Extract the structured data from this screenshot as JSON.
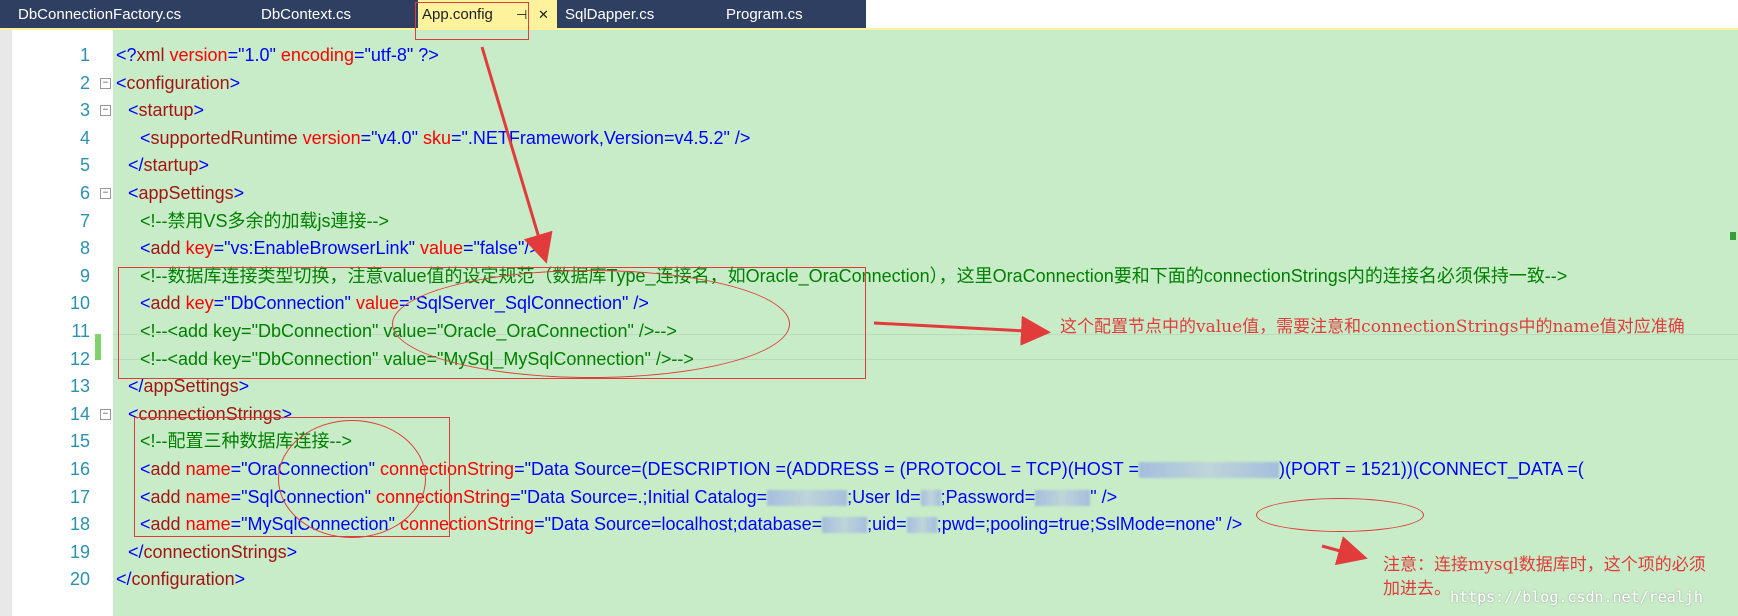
{
  "tabs": [
    {
      "label": "DbConnectionFactory.cs"
    },
    {
      "label": "DbContext.cs"
    },
    {
      "label": "App.config",
      "active": true,
      "pin": "⊣",
      "close": "✕"
    },
    {
      "label": "SqlDapper.cs"
    },
    {
      "label": "Program.cs"
    }
  ],
  "line_numbers": [
    "1",
    "2",
    "3",
    "4",
    "5",
    "6",
    "7",
    "8",
    "9",
    "10",
    "11",
    "12",
    "13",
    "14",
    "15",
    "16",
    "17",
    "18",
    "19",
    "20"
  ],
  "code": {
    "l1": {
      "open": "<?",
      "name": "xml",
      "a1": " version",
      "eq1": "=",
      "v1": "\"1.0\"",
      "a2": " encoding",
      "eq2": "=",
      "v2": "\"utf-8\"",
      "close": " ?>"
    },
    "l2": {
      "open": "<",
      "name": "configuration",
      "close": ">"
    },
    "l3": {
      "open": "<",
      "name": "startup",
      "close": ">"
    },
    "l4": {
      "open": "<",
      "name": "supportedRuntime",
      "a1": " version",
      "eq1": "=",
      "v1": "\"v4.0\"",
      "a2": " sku",
      "eq2": "=",
      "v2": "\".NETFramework,Version=v4.5.2\"",
      "close": " />"
    },
    "l5": {
      "open": "</",
      "name": "startup",
      "close": ">"
    },
    "l6": {
      "open": "<",
      "name": "appSettings",
      "close": ">"
    },
    "l7": {
      "comment": "<!--禁用VS多余的加载js連接-->"
    },
    "l8": {
      "open": "<",
      "name": "add",
      "a1": " key",
      "eq1": "=",
      "v1": "\"vs:EnableBrowserLink\"",
      "a2": " value",
      "eq2": "=",
      "v2": "\"false\"",
      "close": "/>"
    },
    "l9": {
      "comment": "<!--数据库连接类型切换，注意value值的设定规范（数据库Type_连接名，如Oracle_OraConnection），这里OraConnection要和下面的connectionStrings内的连接名必须保持一致-->"
    },
    "l10": {
      "open": "<",
      "name": "add",
      "a1": " key",
      "eq1": "=",
      "v1": "\"DbConnection\"",
      "a2": " value",
      "eq2": "=",
      "v2": "\"SqlServer_SqlConnection\"",
      "close": " />"
    },
    "l11": {
      "comment": "<!--<add key=\"DbConnection\" value=\"Oracle_OraConnection\" />-->"
    },
    "l12": {
      "comment": "<!--<add key=\"DbConnection\" value=\"MySql_MySqlConnection\" />-->"
    },
    "l13": {
      "open": "</",
      "name": "appSettings",
      "close": ">"
    },
    "l14": {
      "open": "<",
      "name": "connectionStrings",
      "close": ">"
    },
    "l15": {
      "comment": "<!--配置三种数据库连接-->"
    },
    "l16": {
      "open": "<",
      "name": "add",
      "a1": " name",
      "eq1": "=",
      "v1": "\"OraConnection\"",
      "a2": "  connectionString",
      "eq2": "=",
      "v2a": "\"Data Source=(DESCRIPTION =(ADDRESS = (PROTOCOL = TCP)(HOST =",
      "v2b": ")(PORT = 1521))(CONNECT_DATA =("
    },
    "l17": {
      "open": "<",
      "name": "add",
      "a1": " name",
      "eq1": "=",
      "v1": "\"SqlConnection\"",
      "a2": "  connectionString",
      "eq2": "=",
      "v2a": "\"Data Source=.;Initial Catalog=",
      "v2b": ";User Id=",
      "v2c": ";Password=",
      "v2d": "\"",
      "close": " />"
    },
    "l18": {
      "open": "<",
      "name": "add",
      "a1": " name",
      "eq1": "=",
      "v1": "\"MySqlConnection\"",
      "a2": "  connectionString",
      "eq2": "=",
      "v2a": "\"Data Source=localhost;database=",
      "v2b": ";uid=",
      "v2c": ";pwd=;pooling=true;SslMode=none\"",
      "close": " />"
    },
    "l19": {
      "open": "</",
      "name": "connectionStrings",
      "close": ">"
    },
    "l20": {
      "open": "</",
      "name": "configuration",
      "close": ">"
    }
  },
  "annotations": {
    "note_value": "这个配置节点中的value值，需要注意和connectionStrings中的name值对应准确",
    "note_mysql_1": "注意：连接mysql数据库时，这个项的必须",
    "note_mysql_2": "加进去。",
    "watermark": "https://blog.csdn.net/realjh"
  },
  "colors": {
    "code_background": "#c8ecc8",
    "tab_strip": "#2f3f61",
    "active_tab": "#fff29d",
    "annotation_red": "#e23b3b"
  }
}
